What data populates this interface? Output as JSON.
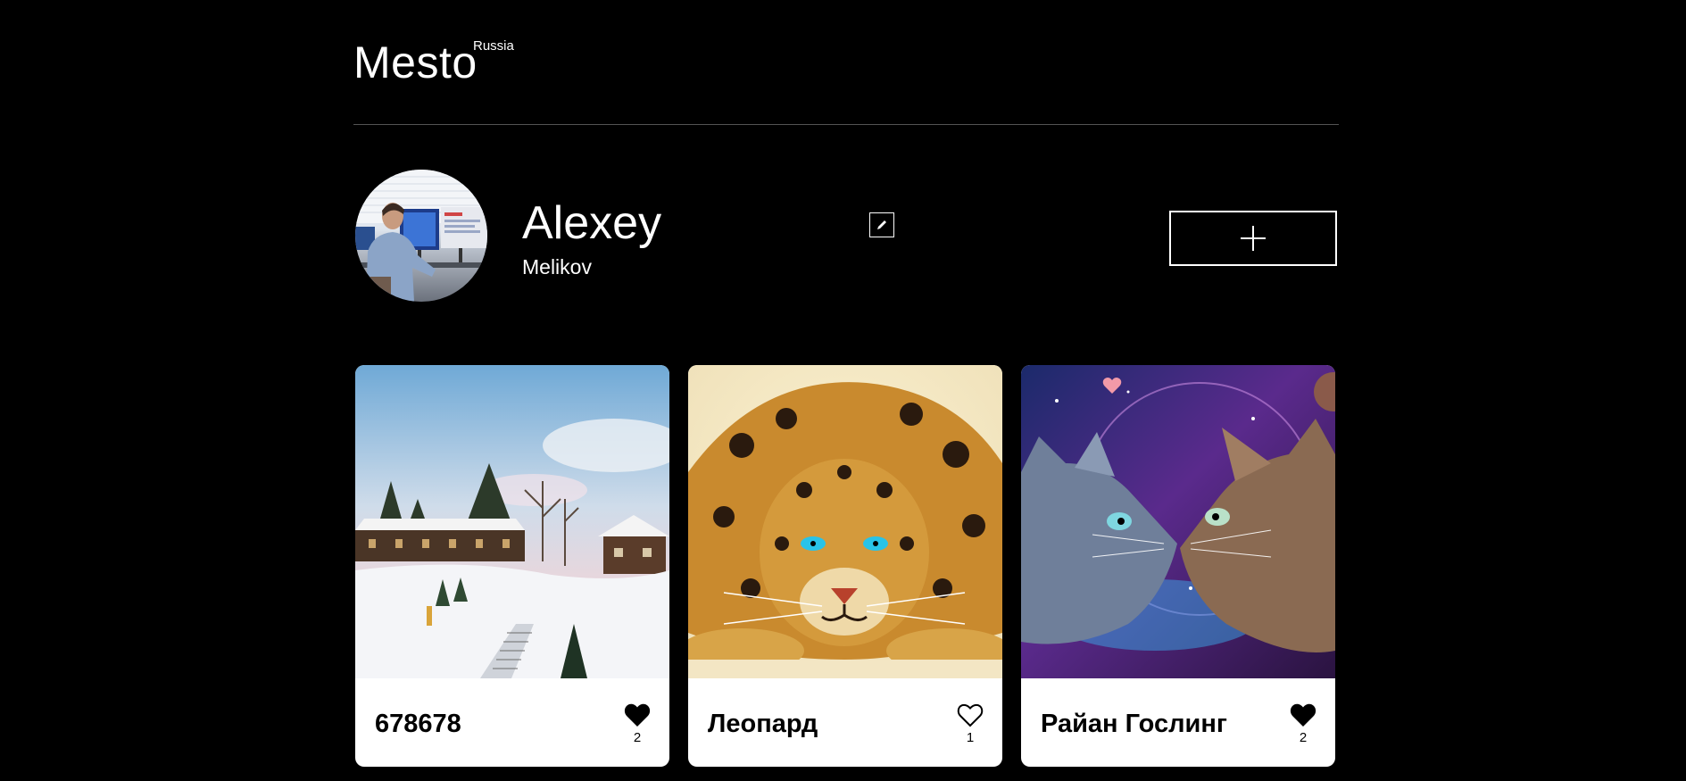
{
  "header": {
    "logo_main": "Mesto",
    "logo_sup": "Russia"
  },
  "profile": {
    "name": "Alexey",
    "about": "Melikov",
    "edit_icon": "pencil-icon",
    "add_icon": "plus-icon"
  },
  "cards": [
    {
      "title": "678678",
      "likes": "2",
      "liked": true,
      "image": "winter-village-photo"
    },
    {
      "title": "Леопард",
      "likes": "1",
      "liked": false,
      "image": "leopard-illustration"
    },
    {
      "title": "Райан Гослинг",
      "likes": "2",
      "liked": true,
      "image": "space-cats-illustration"
    }
  ],
  "colors": {
    "background": "#000000",
    "card": "#ffffff",
    "divider": "#545454"
  }
}
